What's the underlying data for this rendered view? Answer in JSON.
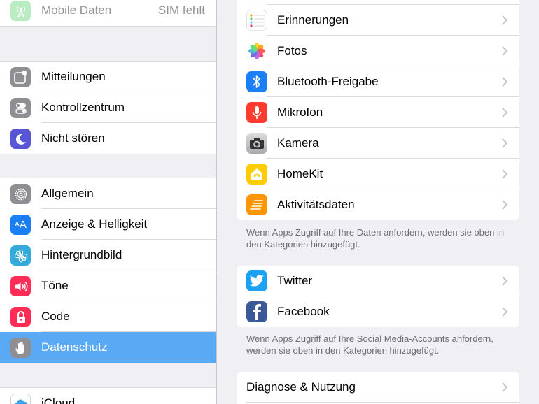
{
  "sidebar": {
    "group0": [
      {
        "label": "Mobile Daten",
        "value": "SIM fehlt",
        "icon": "antenna-icon",
        "color": "#7fd98e"
      }
    ],
    "group1": [
      {
        "label": "Mitteilungen",
        "icon": "notifications-icon",
        "color": "#8e8e93"
      },
      {
        "label": "Kontrollzentrum",
        "icon": "control-center-icon",
        "color": "#8e8e93"
      },
      {
        "label": "Nicht stören",
        "icon": "moon-icon",
        "color": "#5856d6"
      }
    ],
    "group2": [
      {
        "label": "Allgemein",
        "icon": "gear-icon",
        "color": "#8e8e93"
      },
      {
        "label": "Anzeige & Helligkeit",
        "icon": "text-size-icon",
        "color": "#1a7ef5",
        "glyph": "AA"
      },
      {
        "label": "Hintergrundbild",
        "icon": "flower-icon",
        "color": "#34aadc"
      },
      {
        "label": "Töne",
        "icon": "speaker-icon",
        "color": "#ff2d55"
      },
      {
        "label": "Code",
        "icon": "lock-icon",
        "color": "#ff2d55"
      },
      {
        "label": "Datenschutz",
        "icon": "hand-icon",
        "color": "#8e8e93",
        "selected": true
      }
    ],
    "group3": [
      {
        "label": "iCloud",
        "icon": "cloud-icon",
        "color": "#ffffff"
      }
    ]
  },
  "main": {
    "apps": [
      {
        "label": "Erinnerungen",
        "icon": "reminders-icon"
      },
      {
        "label": "Fotos",
        "icon": "photos-icon"
      },
      {
        "label": "Bluetooth-Freigabe",
        "icon": "bluetooth-icon"
      },
      {
        "label": "Mikrofon",
        "icon": "microphone-icon"
      },
      {
        "label": "Kamera",
        "icon": "camera-icon"
      },
      {
        "label": "HomeKit",
        "icon": "home-icon"
      },
      {
        "label": "Aktivitätsdaten",
        "icon": "activity-icon"
      }
    ],
    "apps_footer": "Wenn Apps Zugriff auf Ihre Daten anfordern, werden sie oben in den Kategorien hinzugefügt.",
    "social": [
      {
        "label": "Twitter",
        "icon": "twitter-icon"
      },
      {
        "label": "Facebook",
        "icon": "facebook-icon"
      }
    ],
    "social_footer": "Wenn Apps Zugriff auf Ihre Social Media-Accounts anfordern, werden sie oben in den Kategorien hinzugefügt.",
    "diagnostics": [
      {
        "label": "Diagnose & Nutzung"
      }
    ]
  }
}
